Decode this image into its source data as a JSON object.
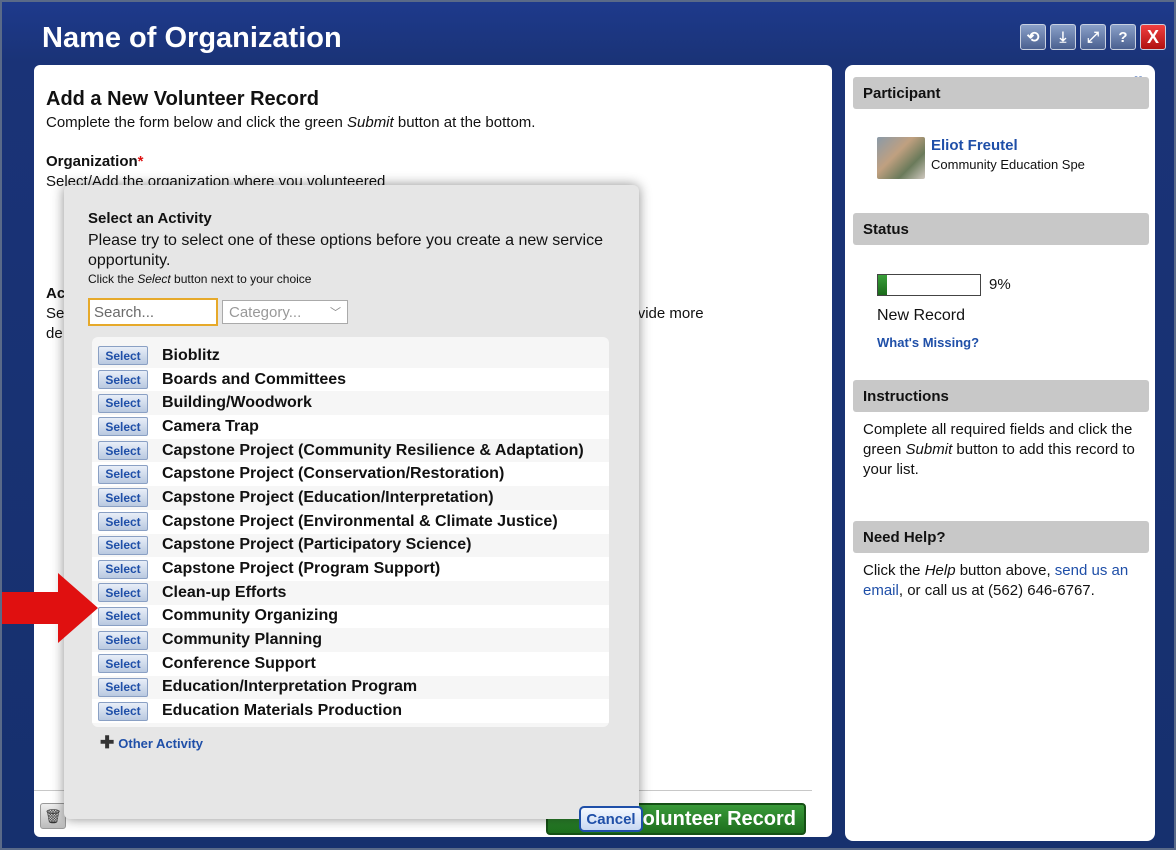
{
  "window": {
    "title": "Name of Organization",
    "controls": [
      "refresh-icon",
      "download-icon",
      "expand-icon",
      "help-icon",
      "close-icon"
    ],
    "control_glyphs": [
      "⟲",
      "⤓",
      "⤢",
      "?",
      "X"
    ]
  },
  "form": {
    "title": "Add a New Volunteer Record",
    "subtitle_pre": "Complete the form below and click the green ",
    "subtitle_em": "Submit",
    "subtitle_post": " button at the bottom.",
    "org_label": "Organization",
    "org_required": "*",
    "org_help": "Select/Add the organization where you volunteered",
    "activity_label": "Ac",
    "activity_help_start": "Se",
    "activity_help_end": "rovide more",
    "activity_help2": "de",
    "submit_label": "Submit Volunteer Record",
    "submit_visible": "olunteer Record"
  },
  "modal": {
    "title": "Select an Activity",
    "description": "Please try to select one of these options before you create a new service opportunity.",
    "hint_pre": "Click the ",
    "hint_em": "Select",
    "hint_post": " button next to your choice",
    "search_placeholder": "Search...",
    "category_placeholder": "Category...",
    "select_label": "Select",
    "activities": [
      "Bioblitz",
      "Boards and Committees",
      "Building/Woodwork",
      "Camera Trap",
      "Capstone Project (Community Resilience & Adaptation)",
      "Capstone Project (Conservation/Restoration)",
      "Capstone Project (Education/Interpretation)",
      "Capstone Project (Environmental & Climate Justice)",
      "Capstone Project (Participatory Science)",
      "Capstone Project (Program Support)",
      "Clean-up Efforts",
      "Community Organizing",
      "Community Planning",
      "Conference Support",
      "Education/Interpretation Program",
      "Education Materials Production"
    ],
    "other_activity": "Other Activity",
    "cancel_label": "Cancel"
  },
  "sidebar": {
    "participant_heading": "Participant",
    "participant_name": "Eliot Freutel",
    "participant_role": "Community Education Spe",
    "status_heading": "Status",
    "progress_percent": 9,
    "progress_label": "9%",
    "record_status": "New Record",
    "whats_missing": "What's Missing?",
    "instructions_heading": "Instructions",
    "instructions_pre": "Complete all required fields and click the green ",
    "instructions_em": "Submit",
    "instructions_post": " button to add this record to your list.",
    "help_heading": "Need Help?",
    "help_pre": "Click the ",
    "help_em": "Help",
    "help_mid": " button above, ",
    "help_link": "send us an email",
    "help_post": ", or call us at (562) 646-6767."
  },
  "colors": {
    "title_bar": "#1a3377",
    "link": "#1f4fa8",
    "submit_green": "#2a8a2a",
    "annotation_arrow": "#e01010",
    "search_focus": "#e6a92a"
  }
}
